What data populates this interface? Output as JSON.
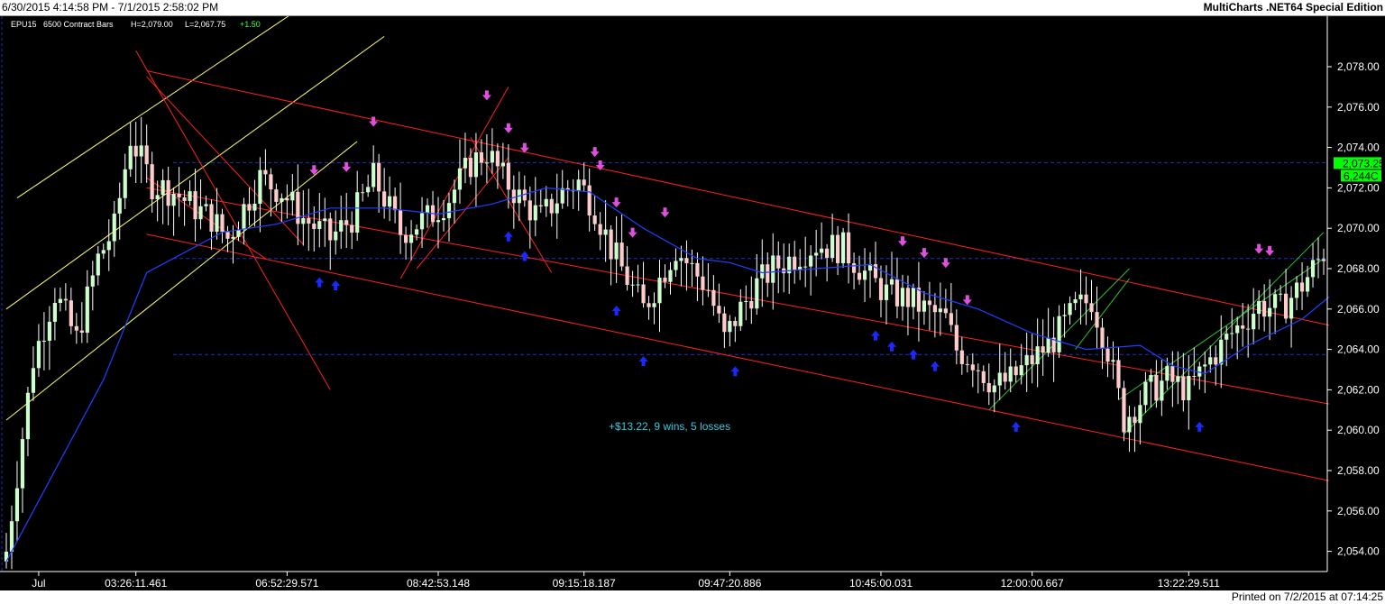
{
  "header": {
    "date_range": "6/30/2015 4:14:58 PM - 7/1/2015 2:58:02 PM",
    "edition": "MultiCharts .NET64 Special Edition"
  },
  "footer": {
    "printed": "Printed on 7/2/2015 at 07:14:25"
  },
  "chart_data": {
    "type": "candlestick",
    "legend": {
      "symbol": "EPU15",
      "bars": "6500 Contract Bars",
      "high": "H=2,079.00",
      "low": "L=2,067.75",
      "change": "+1.50"
    },
    "annotation": "+$13.22, 9 wins, 5 losses",
    "price_tags": [
      "2,073.25",
      "6,244C"
    ],
    "price_tag_value": 2073.25,
    "ylim": [
      2053,
      2080.5
    ],
    "y_ticks": [
      2054,
      2056,
      2058,
      2060,
      2062,
      2064,
      2066,
      2068,
      2070,
      2072,
      2074,
      2076,
      2078
    ],
    "y_tick_labels": [
      "2,054.00",
      "2,056.00",
      "2,058.00",
      "2,060.00",
      "2,062.00",
      "2,064.00",
      "2,066.00",
      "2,068.00",
      "2,070.00",
      "2,072.00",
      "2,074.00",
      "2,076.00",
      "2,078.00"
    ],
    "x_ticks": [
      {
        "label": "Jul",
        "bar": 6
      },
      {
        "label": "03:26:11.461",
        "bar": 24
      },
      {
        "label": "06:52:29.571",
        "bar": 52
      },
      {
        "label": "08:42:53.148",
        "bar": 80
      },
      {
        "label": "09:15:18.187",
        "bar": 107
      },
      {
        "label": "09:47:20.886",
        "bar": 134
      },
      {
        "label": "10:45:00.031",
        "bar": 162
      },
      {
        "label": "12:00:00.667",
        "bar": 190
      },
      {
        "label": "13:22:29.511",
        "bar": 219
      }
    ],
    "bar_count": 245,
    "h_levels": [
      2073.25,
      2068.5,
      2063.75
    ],
    "channels": [
      {
        "color": "#ffff66",
        "lines": [
          [
            0,
            2060.5,
            65,
            2074.3
          ],
          [
            0,
            2066,
            70,
            2079.5
          ],
          [
            2,
            2071.5,
            55,
            2081
          ]
        ]
      },
      {
        "color": "#ff2020",
        "lines": [
          [
            26,
            2077.8,
            245,
            2065.2
          ],
          [
            26,
            2072,
            245,
            2061.3
          ],
          [
            26,
            2069.7,
            245,
            2057.5
          ]
        ]
      },
      {
        "color": "#ff2020",
        "lines": [
          [
            24,
            2078.8,
            60,
            2062
          ],
          [
            26,
            2072.5,
            48,
            2068.5
          ],
          [
            26,
            2077.5,
            55,
            2069.2
          ],
          [
            73,
            2067.5,
            93,
            2077
          ],
          [
            76,
            2068,
            93,
            2073.5
          ],
          [
            86,
            2074.5,
            101,
            2067.8
          ]
        ]
      },
      {
        "color": "#30c030",
        "lines": [
          [
            182,
            2061,
            208,
            2068
          ],
          [
            198,
            2064,
            208,
            2067.5
          ],
          [
            206,
            2061.5,
            244,
            2068.5
          ],
          [
            207,
            2059.8,
            244,
            2069.8
          ]
        ]
      }
    ],
    "ma_points": [
      [
        0,
        2053.5
      ],
      [
        8,
        2057.5
      ],
      [
        18,
        2062.5
      ],
      [
        26,
        2067.8
      ],
      [
        40,
        2069.8
      ],
      [
        50,
        2070.2
      ],
      [
        60,
        2071
      ],
      [
        70,
        2071
      ],
      [
        80,
        2070.7
      ],
      [
        90,
        2071.2
      ],
      [
        100,
        2072
      ],
      [
        108,
        2071.8
      ],
      [
        118,
        2070
      ],
      [
        128,
        2068.5
      ],
      [
        134,
        2068.3
      ],
      [
        140,
        2067.8
      ],
      [
        150,
        2068
      ],
      [
        160,
        2068.2
      ],
      [
        170,
        2066.8
      ],
      [
        180,
        2066
      ],
      [
        190,
        2064.8
      ],
      [
        200,
        2064
      ],
      [
        210,
        2064.2
      ],
      [
        216,
        2063.2
      ],
      [
        222,
        2062.8
      ],
      [
        230,
        2064.2
      ],
      [
        240,
        2065.5
      ],
      [
        245,
        2066.6
      ]
    ],
    "close_path": [
      [
        0,
        2054
      ],
      [
        5,
        2063.5
      ],
      [
        9,
        2066.8
      ],
      [
        13,
        2064.5
      ],
      [
        17,
        2068.5
      ],
      [
        20,
        2070
      ],
      [
        23,
        2074.5
      ],
      [
        27,
        2072.2
      ],
      [
        31,
        2071.8
      ],
      [
        35,
        2071
      ],
      [
        38,
        2070.5
      ],
      [
        41,
        2069.5
      ],
      [
        44,
        2071
      ],
      [
        47,
        2072.5
      ],
      [
        51,
        2071.8
      ],
      [
        55,
        2070.5
      ],
      [
        60,
        2069.5
      ],
      [
        64,
        2070.5
      ],
      [
        68,
        2072.5
      ],
      [
        70,
        2071.5
      ],
      [
        73,
        2069.8
      ],
      [
        78,
        2070.5
      ],
      [
        82,
        2071.5
      ],
      [
        86,
        2073.2
      ],
      [
        89,
        2073.8
      ],
      [
        92,
        2072.5
      ],
      [
        96,
        2071.2
      ],
      [
        99,
        2070.5
      ],
      [
        103,
        2071.8
      ],
      [
        106,
        2072.3
      ],
      [
        109,
        2071
      ],
      [
        112,
        2069
      ],
      [
        115,
        2067.5
      ],
      [
        118,
        2066
      ],
      [
        121,
        2067.5
      ],
      [
        124,
        2069
      ],
      [
        127,
        2068
      ],
      [
        130,
        2067
      ],
      [
        133,
        2064.5
      ],
      [
        136,
        2066
      ],
      [
        139,
        2067.2
      ],
      [
        142,
        2068
      ],
      [
        146,
        2068.6
      ],
      [
        150,
        2069.2
      ],
      [
        155,
        2069
      ],
      [
        160,
        2067.5
      ],
      [
        163,
        2066.8
      ],
      [
        167,
        2066.5
      ],
      [
        170,
        2066
      ],
      [
        174,
        2065.5
      ],
      [
        176,
        2064
      ],
      [
        179,
        2063.5
      ],
      [
        183,
        2062.2
      ],
      [
        186,
        2062.5
      ],
      [
        190,
        2063.5
      ],
      [
        194,
        2064.5
      ],
      [
        198,
        2066
      ],
      [
        201,
        2066.5
      ],
      [
        204,
        2064
      ],
      [
        207,
        2060.5
      ],
      [
        211,
        2061.8
      ],
      [
        215,
        2062.5
      ],
      [
        219,
        2062
      ],
      [
        223,
        2063.5
      ],
      [
        227,
        2064.8
      ],
      [
        232,
        2066.2
      ],
      [
        236,
        2066
      ],
      [
        240,
        2067.2
      ],
      [
        244,
        2068.8
      ]
    ],
    "buy_bars": [
      58,
      61,
      93,
      96,
      113,
      118,
      135,
      161,
      164,
      168,
      172,
      187,
      221
    ],
    "sell_bars": [
      57,
      63,
      68,
      89,
      93,
      96,
      109,
      110,
      113,
      116,
      122,
      166,
      170,
      174,
      178,
      232,
      234
    ],
    "colors": {
      "background": "#000000",
      "up_candle": "#ccffcc",
      "down_candle": "#ffcccc",
      "wick": "#ffffff",
      "ma": "#2040ff",
      "h_level": "#2030c0",
      "buy": "#1a2aff",
      "sell": "#e050e0",
      "annotation": "#33ccdd",
      "axis_text": "#ffffff",
      "price_tag": "#00ff00"
    }
  }
}
